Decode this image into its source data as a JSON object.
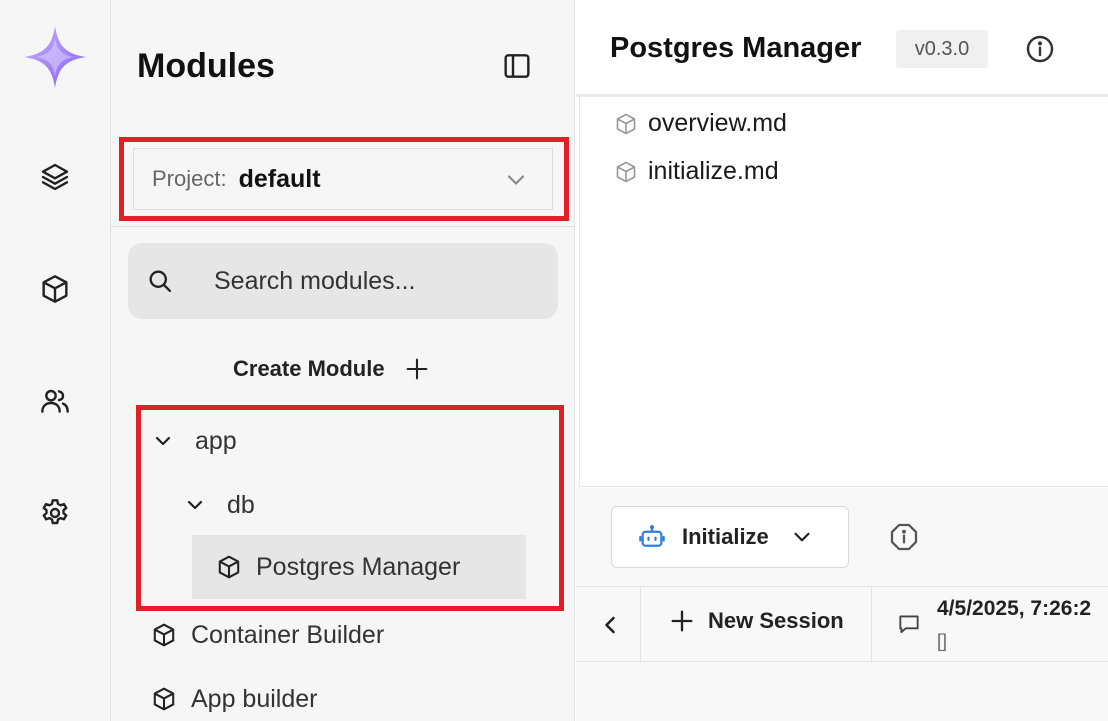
{
  "rail": {
    "logo": "sparkle-logo",
    "items": [
      {
        "icon": "layers-icon"
      },
      {
        "icon": "cube-icon"
      },
      {
        "icon": "users-icon"
      },
      {
        "icon": "gear-icon"
      }
    ]
  },
  "modules": {
    "title": "Modules",
    "project": {
      "label": "Project:",
      "value": "default"
    },
    "search": {
      "placeholder": "Search modules..."
    },
    "create_label": "Create Module",
    "tree": [
      {
        "label": "app",
        "type": "folder",
        "expanded": true
      },
      {
        "label": "db",
        "type": "folder",
        "expanded": true
      },
      {
        "label": "Postgres Manager",
        "type": "module",
        "selected": true
      },
      {
        "label": "Container Builder",
        "type": "module"
      },
      {
        "label": "App builder",
        "type": "module"
      }
    ]
  },
  "main": {
    "title": "Postgres Manager",
    "version": "v0.3.0",
    "docs": [
      {
        "label": "overview.md"
      },
      {
        "label": "initialize.md"
      }
    ],
    "action": {
      "label": "Initialize"
    },
    "session": {
      "new_label": "New Session",
      "timestamp": "4/5/2025, 7:26:2",
      "preview": "[]"
    }
  },
  "colors": {
    "highlight": "#e01f26",
    "accent_blue": "#2f7de1",
    "logo_purple": "#a78bfa"
  }
}
